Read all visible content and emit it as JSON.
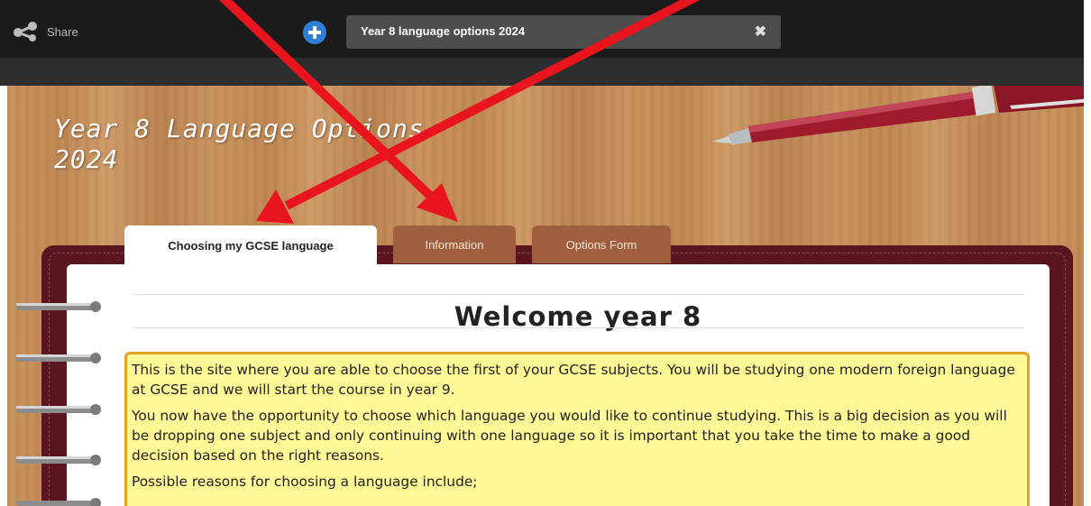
{
  "topbar": {
    "share_label": "Share",
    "tab_title": "Year 8 language options 2024",
    "close_symbol": "✖"
  },
  "site": {
    "title_line1": "Year 8 Language Options",
    "title_line2": "2024"
  },
  "tabs": [
    {
      "label": "Choosing my GCSE language",
      "active": true
    },
    {
      "label": "Information",
      "active": false
    },
    {
      "label": "Options Form",
      "active": false
    }
  ],
  "content": {
    "heading": "Welcome year 8",
    "paragraphs": [
      "This is the site where you are able to choose the first of your GCSE subjects. You will be studying one modern foreign language at GCSE and we will start the course in year 9.",
      "You now have the opportunity to choose which language you would like to continue studying. This is a big decision as you will be dropping one subject and only continuing with one language so it is important that you take the time to make a good decision based on the right reasons.",
      "Possible reasons for choosing a language include;"
    ]
  },
  "colors": {
    "topbar_bg": "#1b1b1b",
    "accent_blue": "#2f7fd6",
    "tab_inactive": "#a0603f",
    "notebook_cover": "#5a1520",
    "note_bg": "#fef896",
    "note_border": "#e5a21e",
    "arrow_red": "#e8141e"
  },
  "icons": {
    "share": "share-icon",
    "add": "plus-icon",
    "close": "close-icon"
  }
}
